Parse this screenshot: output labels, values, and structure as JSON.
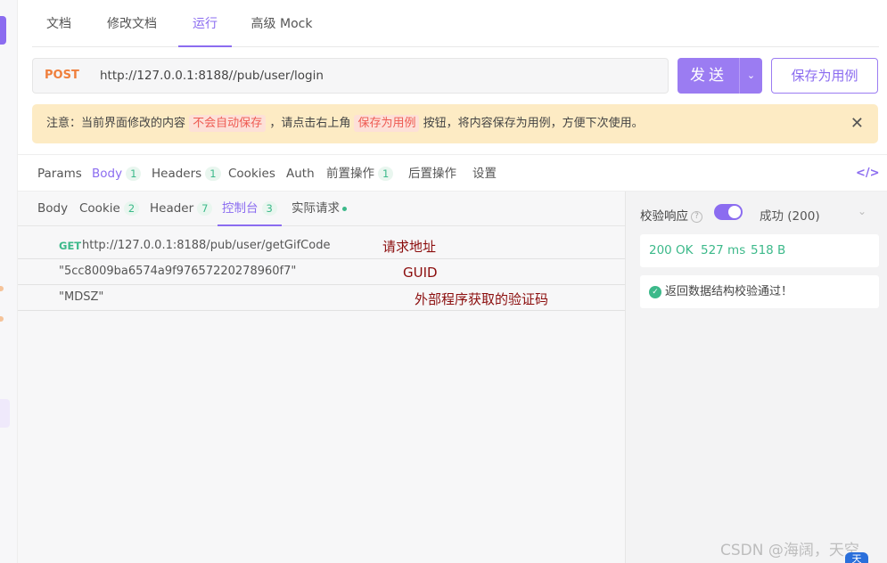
{
  "top_tabs": [
    {
      "label": "文档"
    },
    {
      "label": "修改文档"
    },
    {
      "label": "运行"
    },
    {
      "label": "高级 Mock"
    }
  ],
  "request": {
    "method": "POST",
    "url": "http://127.0.0.1:8188//pub/user/login",
    "send_label": "发送",
    "save_label": "保存为用例"
  },
  "notice": {
    "prefix": "注意：当前界面修改的内容",
    "hl1": "不会自动保存",
    "middle": "，请点击右上角",
    "hl2": "保存为用例",
    "suffix": "按钮，将内容保存为用例，方便下次使用。"
  },
  "request_tabs": [
    {
      "label": "Params",
      "badge": ""
    },
    {
      "label": "Body",
      "badge": "1"
    },
    {
      "label": "Headers",
      "badge": "1"
    },
    {
      "label": "Cookies",
      "badge": ""
    },
    {
      "label": "Auth",
      "badge": ""
    },
    {
      "label": "前置操作",
      "badge": "1"
    },
    {
      "label": "后置操作",
      "badge": ""
    },
    {
      "label": "设置",
      "badge": ""
    }
  ],
  "code_icon": "</>",
  "response_tabs": [
    {
      "label": "Body",
      "badge": ""
    },
    {
      "label": "Cookie",
      "badge": "2"
    },
    {
      "label": "Header",
      "badge": "7"
    },
    {
      "label": "控制台",
      "badge": "3"
    },
    {
      "label": "实际请求",
      "badge": ""
    }
  ],
  "console": [
    {
      "method": "GET",
      "text": "http://127.0.0.1:8188/pub/user/getGifCode",
      "annotation": "请求地址"
    },
    {
      "method": "",
      "text": "\"5cc8009ba6574a9f97657220278960f7\"",
      "annotation": "GUID"
    },
    {
      "method": "",
      "text": "\"MDSZ\"",
      "annotation": "外部程序获取的验证码"
    }
  ],
  "validation": {
    "label": "校验响应",
    "help": "?",
    "enabled": true,
    "selected": "成功 (200)",
    "status_code": "200 OK",
    "time": "527 ms",
    "size": "518 B",
    "message": "返回数据结构校验通过！"
  },
  "watermark": "CSDN @海阔，天空",
  "corner_badge": "天",
  "colors": {
    "accent": "#8b6cf0",
    "post": "#ef7f3c",
    "success": "#3cb98a",
    "annotation": "#8b0d0d",
    "notice_bg": "#fdebc4"
  }
}
